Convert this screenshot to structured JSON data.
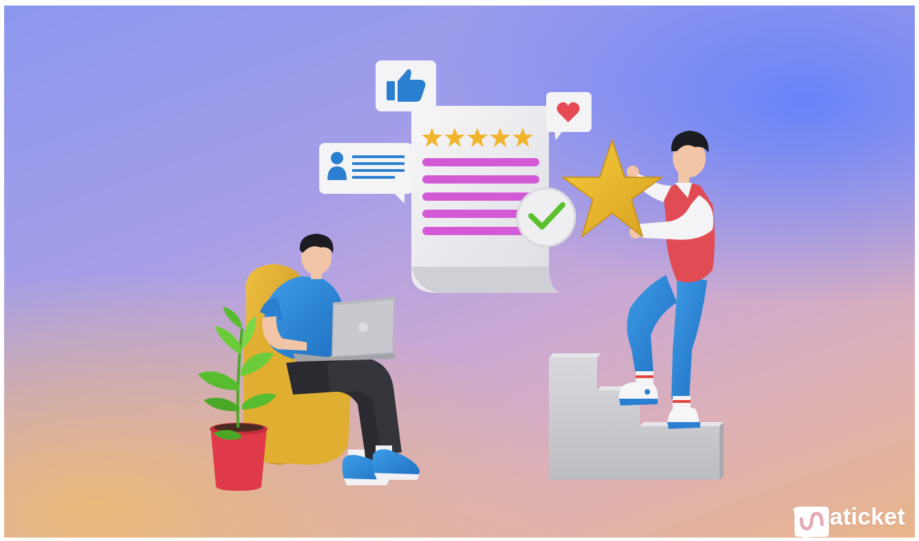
{
  "brand": {
    "name": "Whaticket"
  },
  "review_card": {
    "rating_stars": 5,
    "text_line_count": 5,
    "accent_color": "#d35ad4",
    "star_color": "#f0b52d"
  },
  "badges": [
    "thumbs-up-icon",
    "heart-icon",
    "user-profile-icon",
    "checkmark-icon"
  ],
  "colors": {
    "background_top_right": "#6282fa",
    "background_bottom_left": "#eab878",
    "plant_pot": "#e0394a",
    "armchair": "#d9a828",
    "brand_text": "#ffffff"
  }
}
